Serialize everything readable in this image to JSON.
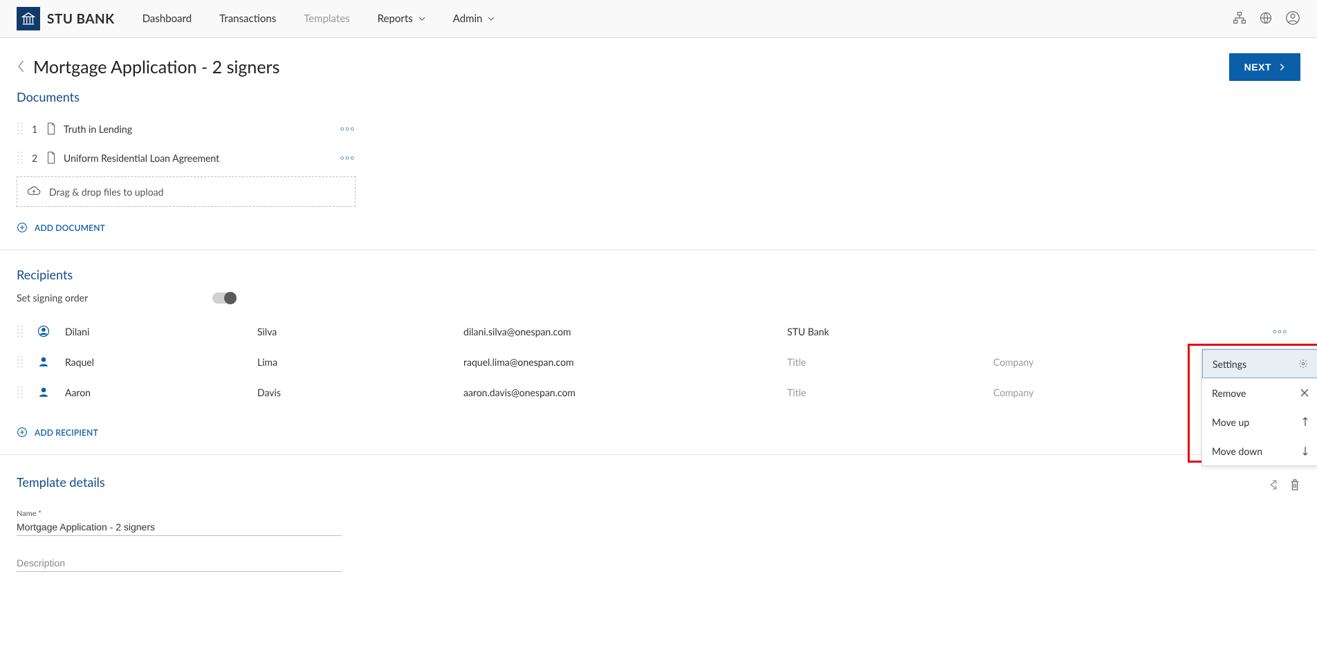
{
  "brand": {
    "name": "STU BANK"
  },
  "nav": {
    "dashboard": "Dashboard",
    "transactions": "Transactions",
    "templates": "Templates",
    "reports": "Reports",
    "admin": "Admin"
  },
  "header": {
    "page_title": "Mortgage Application - 2 signers",
    "next_label": "NEXT"
  },
  "documents": {
    "heading": "Documents",
    "items": [
      {
        "index": "1",
        "name": "Truth in Lending"
      },
      {
        "index": "2",
        "name": "Uniform Residential Loan Agreement"
      }
    ],
    "dropzone_text": "Drag & drop files to upload",
    "add_label": "ADD DOCUMENT"
  },
  "recipients": {
    "heading": "Recipients",
    "signing_order_label": "Set signing order",
    "add_label": "ADD RECIPIENT",
    "title_placeholder": "Title",
    "company_placeholder": "Company",
    "rows": [
      {
        "first": "Dilani",
        "last": "Silva",
        "email": "dilani.silva@onespan.com",
        "title": "",
        "company": "STU Bank",
        "owner": true
      },
      {
        "first": "Raquel",
        "last": "Lima",
        "email": "raquel.lima@onespan.com",
        "title": "",
        "company": "",
        "owner": false
      },
      {
        "first": "Aaron",
        "last": "Davis",
        "email": "aaron.davis@onespan.com",
        "title": "",
        "company": "",
        "owner": false
      }
    ]
  },
  "context_menu": {
    "settings": "Settings",
    "remove": "Remove",
    "move_up": "Move up",
    "move_down": "Move down"
  },
  "template_details": {
    "heading": "Template details",
    "name_label": "Name",
    "name_value": "Mortgage Application - 2 signers",
    "description_placeholder": "Description"
  }
}
